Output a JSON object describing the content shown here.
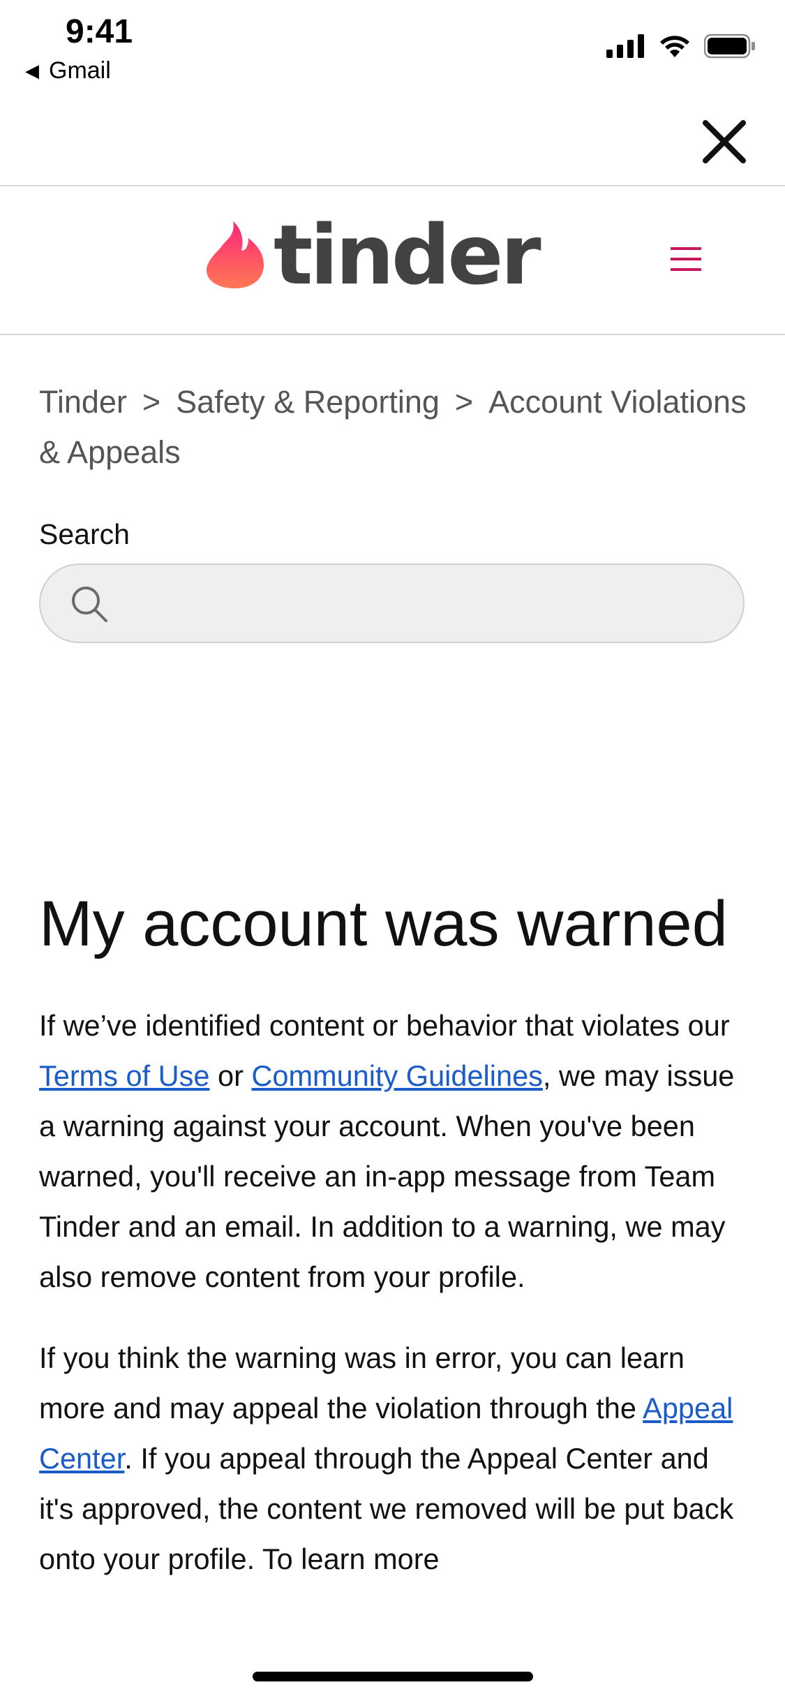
{
  "status_bar": {
    "time": "9:41",
    "back_app": "Gmail",
    "icons": [
      "signal-icon",
      "wifi-icon",
      "battery-icon"
    ]
  },
  "top_bar": {
    "close_icon": "close-icon"
  },
  "header": {
    "logo_text": "tinder",
    "logo_icon": "flame-icon",
    "menu_icon": "hamburger-menu-icon",
    "accent_color": "#c8175d",
    "flame_gradient": [
      "#fd267a",
      "#ff7854"
    ]
  },
  "breadcrumb": {
    "items": [
      "Tinder",
      "Safety & Reporting",
      "Account Violations & Appeals"
    ],
    "separator": ">"
  },
  "search": {
    "label": "Search",
    "value": "",
    "placeholder": ""
  },
  "article": {
    "title": "My account was warned",
    "para1": {
      "before": "If we’ve identified content or behavior that violates our ",
      "link1": "Terms of Use",
      "mid": " or ",
      "link2": "Community Guidelines",
      "after": ", we may issue a warning against your account. When you've been warned, you'll receive an in-app message from Team Tinder and an email. In addition to a warning, we may also remove content from your profile."
    },
    "para2": {
      "before": "If you think the warning was in error, you can learn more and may appeal the violation through the ",
      "link": "Appeal Center",
      "after": ". If you appeal through the Appeal Center and it's approved, the content we removed will be put back onto your profile. To learn more"
    }
  },
  "colors": {
    "link": "#1a5cc8",
    "text": "#111111",
    "muted": "#555555"
  }
}
